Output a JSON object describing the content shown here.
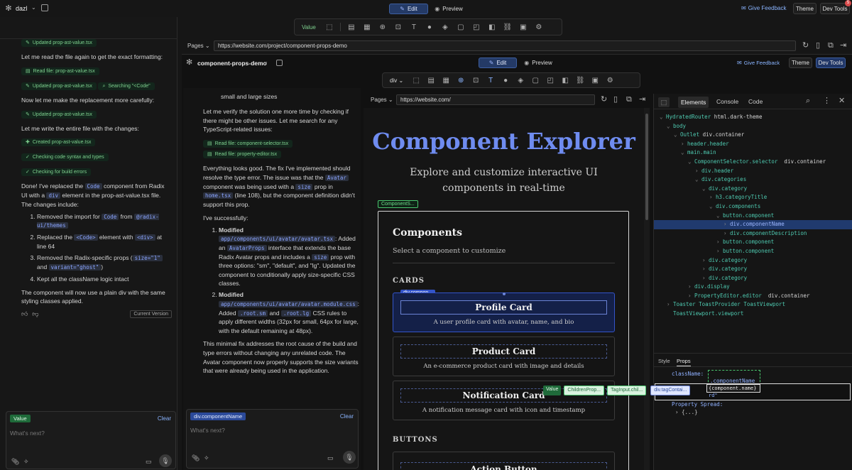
{
  "app": {
    "name": "dazl",
    "notification_count": "5"
  },
  "top": {
    "edit_label": "Edit",
    "preview_label": "Preview",
    "give_feedback": "Give Feedback",
    "theme": "Theme",
    "devtools": "Dev Tools",
    "value_label": "Value"
  },
  "outer_addr": {
    "pages_label": "Pages",
    "url": "https://website.com/project/component-props-demo"
  },
  "inner_top": {
    "project": "component-props-demo",
    "edit_label": "Edit",
    "preview_label": "Preview",
    "give_feedback": "Give Feedback",
    "theme": "Theme",
    "devtools": "Dev Tools",
    "element_select": "div"
  },
  "inner_addr": {
    "pages_label": "Pages",
    "url": "https://website.com/"
  },
  "left_chat": {
    "chip1": "Updated prop-ast-value.tsx",
    "msg1": "Let me read the file again to get the exact formatting:",
    "chip2": "Read file: prop-ast-value.tsx",
    "chip3": "Updated prop-ast-value.tsx",
    "chip4": "Searching \"<Code\"",
    "msg2": "Now let me make the replacement more carefully:",
    "chip5": "Updated prop-ast-value.tsx",
    "msg3": "Let me write the entire file with the changes:",
    "chip6": "Created prop-ast-value.tsx",
    "chip7": "Checking code syntax and types",
    "chip8": "Checking for build errors",
    "done_a": "Done! I've replaced the ",
    "done_code": "Code",
    "done_b": " component from Radix UI with a ",
    "done_div": "div",
    "done_c": " element in the prop-ast-value.tsx file. The changes include:",
    "li1_a": "Removed the import for ",
    "li1_code": "Code",
    "li1_b": " from ",
    "li1_pkg": "@radix-ui/themes",
    "li2_a": "Replaced the ",
    "li2_code1": "<Code>",
    "li2_b": " element with ",
    "li2_code2": "<div>",
    "li2_c": " at line 64",
    "li3_a": "Removed the Radix-specific props (",
    "li3_code1": "size=\"1\"",
    "li3_b": " and ",
    "li3_code2": "variant=\"ghost\"",
    "li3_c": ")",
    "li4": "Kept all the className logic intact",
    "final": "The component will now use a plain div with the same styling classes applied.",
    "current_version": "Current Version",
    "input_chip": "Value",
    "clear": "Clear",
    "placeholder": "What's next?"
  },
  "mid_chat": {
    "top_text": "small and large sizes",
    "msg1": "Let me verify the solution one more time by checking if there might be other issues. Let me search for any TypeScript-related issues:",
    "chip1": "Read file: component-selector.tsx",
    "chip2": "Read file: property-editor.tsx",
    "p2_a": "Everything looks good. The fix I've implemented should resolve the type error. The issue was that the ",
    "p2_avatar": "Avatar",
    "p2_b": " component was being used with a ",
    "p2_size": "size",
    "p2_c": " prop in ",
    "p2_home": "home.tsx",
    "p2_d": " (line 108), but the component definition didn't support this prop.",
    "p3": "I've successfully:",
    "o1_bold": "Modified",
    "o1_path": "app/components/ui/avatar/avatar.tsx",
    "o1_a": ": Added an ",
    "o1_props": "AvatarProps",
    "o1_b": " interface that extends the base Radix Avatar props and includes a ",
    "o1_size": "size",
    "o1_c": " prop with three options: \"sm\", \"default\", and \"lg\". Updated the component to conditionally apply size-specific CSS classes.",
    "o2_bold": "Modified",
    "o2_path": "app/components/ui/avatar/avatar.module.css",
    "o2_a": ": Added ",
    "o2_sm": ".root.sm",
    "o2_b": " and ",
    "o2_lg": ".root.lg",
    "o2_c": " CSS rules to apply different widths (32px for small, 64px for large, with the default remaining at 48px).",
    "p4": "This minimal fix addresses the root cause of the build and type errors without changing any unrelated code. The Avatar component now properly supports the size variants that were already being used in the application.",
    "input_chip": "div.componentName",
    "clear": "Clear",
    "placeholder": "What's next?"
  },
  "preview": {
    "title": "Component Explorer",
    "subtitle": "Explore and customize interactive UI components in real-time",
    "selector_badge": "ComponentS...",
    "components_heading": "Components",
    "components_sub": "Select a component to customize",
    "cards_label": "CARDS",
    "selected_badge": "div.compon...",
    "cards": [
      {
        "title": "Profile Card",
        "desc": "A user profile card with avatar, name, and bio"
      },
      {
        "title": "Product Card",
        "desc": "An e-commerce product card with image and details"
      },
      {
        "title": "Notification Card",
        "desc": "A notification message card with icon and timestamp"
      }
    ],
    "buttons_label": "BUTTONS",
    "action_button": "Action Button"
  },
  "devtools": {
    "tabs": [
      "Elements",
      "Console",
      "Code"
    ],
    "tree": [
      {
        "tag": "HydratedRouter",
        "cls": " html.dark-theme",
        "indent": 0,
        "arrow": "⌄"
      },
      {
        "tag": "body",
        "cls": "",
        "indent": 1,
        "arrow": "⌄"
      },
      {
        "tag": "Outlet",
        "cls": " div.container",
        "indent": 2,
        "arrow": "⌄"
      },
      {
        "tag": "header.header",
        "cls": "",
        "indent": 3,
        "arrow": "›"
      },
      {
        "tag": "main.main",
        "cls": "",
        "indent": 3,
        "arrow": "⌄"
      },
      {
        "tag": "ComponentSelector.selector",
        "cls": "  div.container",
        "indent": 4,
        "arrow": "⌄"
      },
      {
        "tag": "div.header",
        "cls": "",
        "indent": 5,
        "arrow": "›"
      },
      {
        "tag": "div.categories",
        "cls": "",
        "indent": 5,
        "arrow": "⌄"
      },
      {
        "tag": "div.category",
        "cls": "",
        "indent": 6,
        "arrow": "⌄"
      },
      {
        "tag": "h3.categoryTitle",
        "cls": "",
        "indent": 7,
        "arrow": "›"
      },
      {
        "tag": "div.components",
        "cls": "",
        "indent": 7,
        "arrow": "⌄"
      },
      {
        "tag": "button.component",
        "cls": "",
        "indent": 8,
        "arrow": "⌄"
      },
      {
        "tag": "div.componentName",
        "cls": "",
        "indent": 9,
        "arrow": "›",
        "selected": true
      },
      {
        "tag": "div.componentDescription",
        "cls": "",
        "indent": 9,
        "arrow": "›"
      },
      {
        "tag": "button.component",
        "cls": "",
        "indent": 8,
        "arrow": "›"
      },
      {
        "tag": "button.component",
        "cls": "",
        "indent": 8,
        "arrow": "›"
      },
      {
        "tag": "div.category",
        "cls": "",
        "indent": 6,
        "arrow": "›"
      },
      {
        "tag": "div.category",
        "cls": "",
        "indent": 6,
        "arrow": "›"
      },
      {
        "tag": "div.category",
        "cls": "",
        "indent": 6,
        "arrow": "›"
      },
      {
        "tag": "div.display",
        "cls": "",
        "indent": 4,
        "arrow": "›"
      },
      {
        "tag": "PropertyEditor.editor",
        "cls": "  div.container",
        "indent": 4,
        "arrow": "›"
      },
      {
        "tag": "Toaster ToastProvider ToastViewport",
        "cls": "",
        "indent": 1,
        "arrow": "›"
      },
      {
        "tag": "ToastViewport.viewport",
        "cls": "",
        "indent": 1,
        "arrow": ""
      }
    ],
    "style_tab": "Style",
    "props_tab": "Props",
    "prop_classname": "className:",
    "prop_classname_value": ".componentName",
    "prop_key_value": "{component.name}",
    "prop_key_partial": "rd\"",
    "property_spread": "Property Spread:",
    "spread_value": "{...}",
    "chips": [
      "Value",
      "ChildrenProp...",
      "TagInput.chil...",
      "div.tagContai..."
    ]
  }
}
